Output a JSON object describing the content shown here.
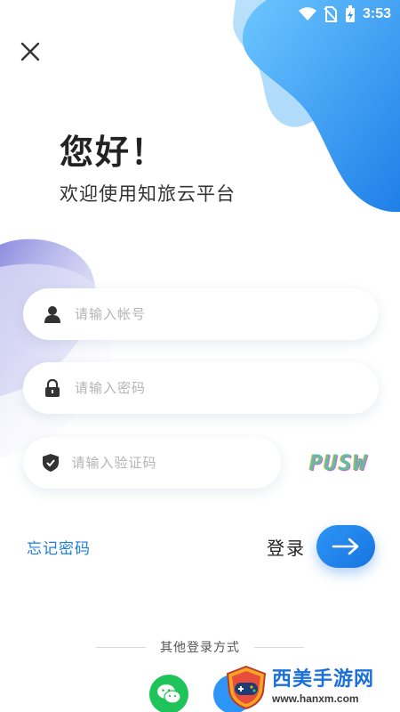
{
  "status_bar": {
    "time": "3:53",
    "icons": [
      "wifi-icon",
      "no-sim-icon",
      "battery-charging-icon"
    ]
  },
  "header": {
    "close_icon": "close-icon"
  },
  "greeting": {
    "title": "您好！",
    "subtitle": "欢迎使用知旅云平台"
  },
  "form": {
    "account": {
      "placeholder": "请输入帐号",
      "value": "",
      "icon": "user-icon"
    },
    "password": {
      "placeholder": "请输入密码",
      "value": "",
      "icon": "lock-icon"
    },
    "captcha": {
      "placeholder": "请输入验证码",
      "value": "",
      "icon": "shield-icon",
      "image_text": "PUSW"
    }
  },
  "actions": {
    "forgot_password": "忘记密码",
    "login_label": "登录",
    "login_icon": "arrow-right-icon"
  },
  "other_login": {
    "label": "其他登录方式",
    "methods": [
      "wechat-icon",
      "other-login-icon"
    ]
  },
  "watermark": {
    "title": "西美手游网",
    "url": "www.hanxm.com"
  },
  "colors": {
    "accent": "#1e7fd8",
    "blob_blue": "#2d95f5",
    "blob_purple": "#8f8fe0",
    "wechat": "#1ec35a",
    "text_primary": "#222222",
    "placeholder": "#b5b5b5"
  }
}
